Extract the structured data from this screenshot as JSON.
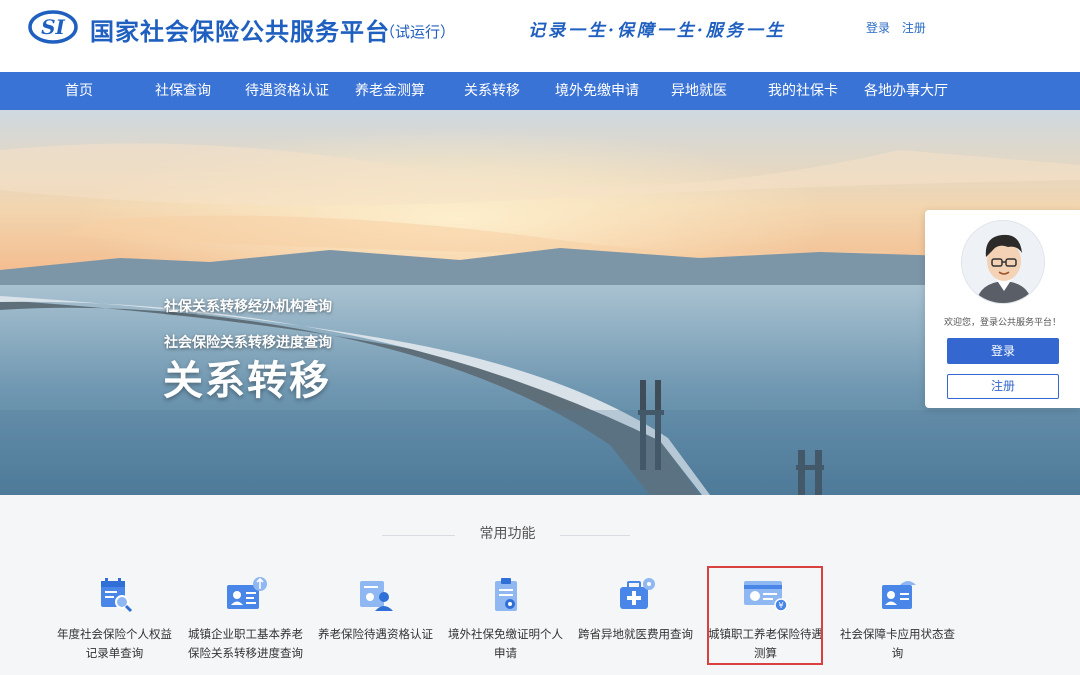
{
  "header": {
    "logo_text": "SI",
    "title": "国家社会保险公共服务平台",
    "status": "（试运行）",
    "slogan": "记录一生·保障一生·服务一生",
    "login_link": "登录",
    "register_link": "注册"
  },
  "nav": {
    "items": [
      {
        "label": "首页"
      },
      {
        "label": "社保查询"
      },
      {
        "label": "待遇资格认证"
      },
      {
        "label": "养老金测算"
      },
      {
        "label": "关系转移"
      },
      {
        "label": "境外免缴申请"
      },
      {
        "label": "异地就医"
      },
      {
        "label": "我的社保卡"
      },
      {
        "label": "各地办事大厅"
      }
    ]
  },
  "banner": {
    "title": "关系转移",
    "links": [
      {
        "label": "社保关系转移经办机构查询"
      },
      {
        "label": "社会保险关系转移进度查询"
      }
    ]
  },
  "login_card": {
    "welcome": "欢迎您，登录公共服务平台！",
    "login_button": "登录",
    "register_button": "注册"
  },
  "common": {
    "title": "常用功能",
    "items": [
      {
        "label": "年度社会保险个人权益记录单查询",
        "icon": "calendar-search-icon"
      },
      {
        "label": "城镇企业职工基本养老保险关系转移进度查询",
        "icon": "id-card-transfer-icon"
      },
      {
        "label": "养老保险待遇资格认证",
        "icon": "certificate-user-icon"
      },
      {
        "label": "境外社保免缴证明个人申请",
        "icon": "clipboard-document-icon"
      },
      {
        "label": "跨省异地就医费用查询",
        "icon": "medical-kit-icon"
      },
      {
        "label": "城镇职工养老保险待遇测算",
        "icon": "calculator-card-icon",
        "highlighted": true
      },
      {
        "label": "社会保障卡应用状态查询",
        "icon": "social-card-icon"
      }
    ]
  },
  "colors": {
    "brand_blue": "#1f5fbf",
    "nav_blue": "#3a73d6",
    "button_blue": "#3468d0",
    "highlight_red": "#d94040"
  }
}
